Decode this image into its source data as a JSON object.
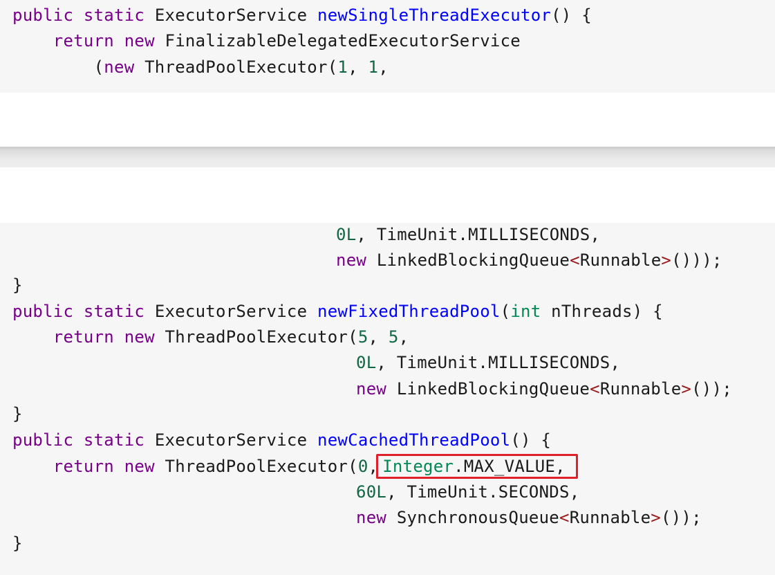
{
  "snippet_top": {
    "l1": {
      "kw1": "public",
      "kw2": "static",
      "ret": "ExecutorService",
      "fn": "newSingleThreadExecutor",
      "tail": "() {"
    },
    "l2": {
      "kw1": "return",
      "kw2": "new",
      "cls": "FinalizableDelegatedExecutorService"
    },
    "l3": {
      "open": "(",
      "kw": "new",
      "cls": "ThreadPoolExecutor(",
      "n1": "1",
      "sep": ", ",
      "n2": "1",
      "tail": ","
    }
  },
  "snippet_bottom": {
    "l1": {
      "num": "0L",
      "rest": ", TimeUnit.MILLISECONDS,"
    },
    "l2": {
      "kw": "new",
      "cls": "LinkedBlockingQueue",
      "lt": "<",
      "gen": "Runnable",
      "gt": ">",
      "tail": "()));"
    },
    "l3": {
      "brace": "}"
    },
    "l4": {
      "kw1": "public",
      "kw2": "static",
      "ret": "ExecutorService",
      "fn": "newFixedThreadPool",
      "open": "(",
      "ptype": "int",
      "param": "nThreads",
      "tail": ") {"
    },
    "l5": {
      "kw1": "return",
      "kw2": "new",
      "cls": "ThreadPoolExecutor(",
      "n1": "5",
      "sep": ", ",
      "n2": "5",
      "tail": ","
    },
    "l6": {
      "num": "0L",
      "rest": ", TimeUnit.MILLISECONDS,"
    },
    "l7": {
      "kw": "new",
      "cls": "LinkedBlockingQueue",
      "lt": "<",
      "gen": "Runnable",
      "gt": ">",
      "tail": "());"
    },
    "l8": {
      "brace": "}"
    },
    "l9": {
      "kw1": "public",
      "kw2": "static",
      "ret": "ExecutorService",
      "fn": "newCachedThreadPool",
      "tail": "() {"
    },
    "l10": {
      "kw1": "return",
      "kw2": "new",
      "cls": "ThreadPoolExecutor(",
      "n1": "0",
      "sep": ",",
      "hl_type": "Integer",
      "hl_rest": ".MAX_VALUE,"
    },
    "l11": {
      "num": "60L",
      "rest": ", TimeUnit.SECONDS,"
    },
    "l12": {
      "kw": "new",
      "cls": "SynchronousQueue",
      "lt": "<",
      "gen": "Runnable",
      "gt": ">",
      "tail": "());"
    },
    "l13": {
      "brace": "}"
    }
  },
  "highlight_color": "#e0202a"
}
